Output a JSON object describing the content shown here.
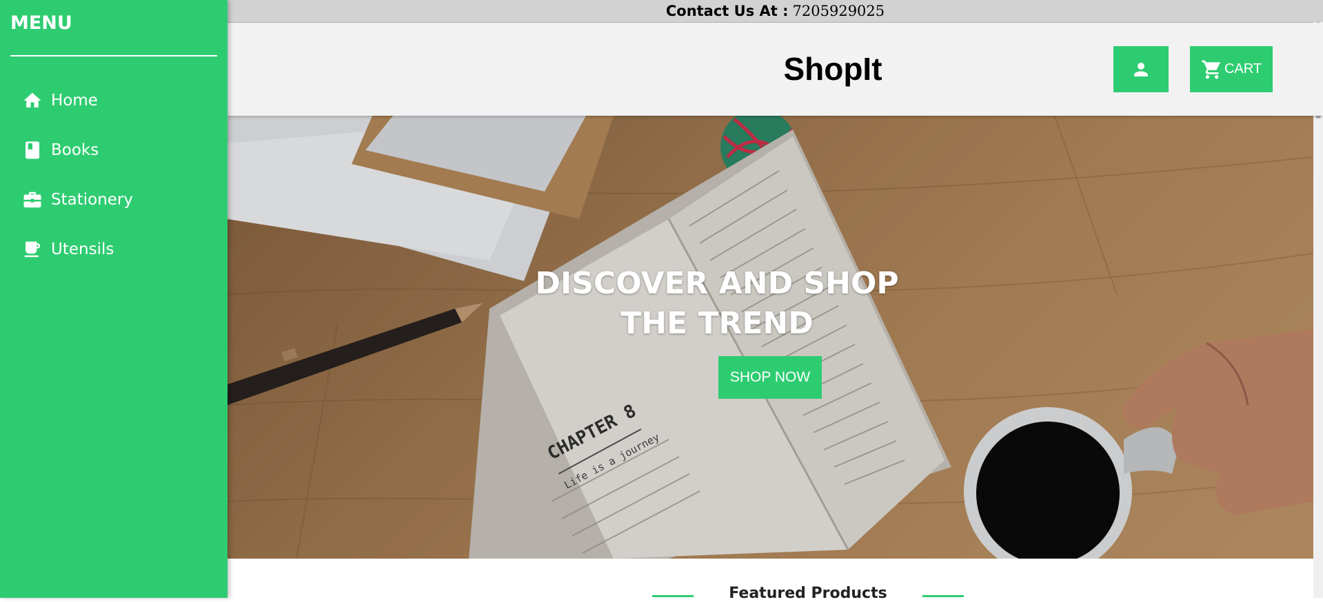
{
  "sidebar": {
    "title": "MENU",
    "items": [
      {
        "label": "Home",
        "icon": "home-icon"
      },
      {
        "label": "Books",
        "icon": "book-icon"
      },
      {
        "label": "Stationery",
        "icon": "briefcase-icon"
      },
      {
        "label": "Utensils",
        "icon": "cup-icon"
      }
    ]
  },
  "contact": {
    "label": "Contact Us At :",
    "phone": "7205929025"
  },
  "header": {
    "brand": "ShopIt",
    "user_icon": "user-icon",
    "cart_icon": "cart-icon",
    "cart_label": "CART"
  },
  "hero": {
    "title_line1": "DISCOVER AND SHOP",
    "title_line2": "THE TREND",
    "button_label": "SHOP NOW",
    "book_chapter": "CHAPTER 8",
    "book_subtitle": "Life is a journey"
  },
  "featured": {
    "title": "Featured Products"
  },
  "colors": {
    "accent": "#2ecc71",
    "header_bg": "#f2f2f2",
    "contact_bg": "#d2d2d2"
  }
}
